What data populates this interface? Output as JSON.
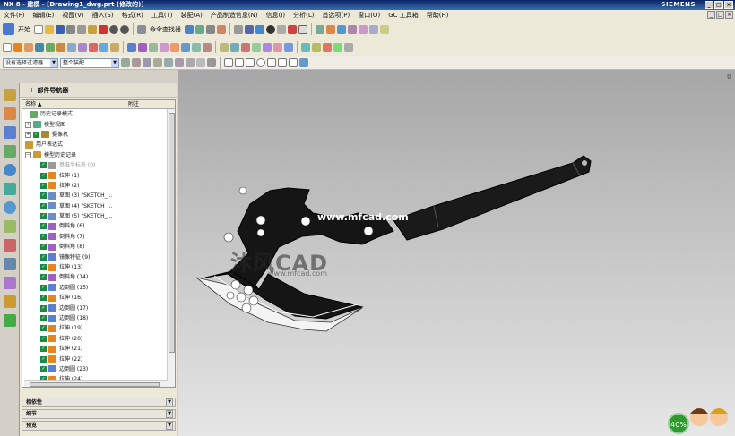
{
  "window": {
    "app_title": "NX 8 - 建模 - [Drawing1_dwg.prt (修改的)]",
    "brand": "SIEMENS"
  },
  "menu": [
    "文件(F)",
    "编辑(E)",
    "视图(V)",
    "插入(S)",
    "格式(R)",
    "工具(T)",
    "装配(A)",
    "产品制造信息(N)",
    "信息(I)",
    "分析(L)",
    "首选项(P)",
    "窗口(O)",
    "GC 工具箱",
    "帮助(H)"
  ],
  "toolbar": {
    "start_label": "开始",
    "cmd_finder": "命令查找器"
  },
  "selection": {
    "filter": "没有选择过滤器",
    "scope": "整个装配"
  },
  "nav": {
    "title": "部件导航器",
    "col_name": "名称",
    "col_note": "附注",
    "items": [
      {
        "label": "历史记录模式",
        "style": "root",
        "color": "#6a6"
      },
      {
        "label": "模型视图",
        "style": "exp",
        "color": "#5a8"
      },
      {
        "label": "摄像机",
        "style": "exp",
        "color": "#a83"
      },
      {
        "label": "用户表达式",
        "style": "plain",
        "color": "#c93"
      },
      {
        "label": "模型历史记录",
        "style": "open",
        "color": "#c93"
      },
      {
        "label": "基准坐标系 (0)",
        "style": "gray",
        "color": "#999"
      },
      {
        "label": "拉伸 (1)",
        "style": "feat",
        "color": "#e8841c"
      },
      {
        "label": "拉伸 (2)",
        "style": "feat",
        "color": "#e8841c"
      },
      {
        "label": "草图 (3) \"SKETCH_...",
        "style": "feat",
        "color": "#6a8cc8"
      },
      {
        "label": "草图 (4) \"SKETCH_...",
        "style": "feat",
        "color": "#6a8cc8"
      },
      {
        "label": "草图 (5) \"SKETCH_...",
        "style": "feat",
        "color": "#6a8cc8"
      },
      {
        "label": "倒斜角 (6)",
        "style": "feat",
        "color": "#a060c0"
      },
      {
        "label": "倒斜角 (7)",
        "style": "feat",
        "color": "#a060c0"
      },
      {
        "label": "倒斜角 (8)",
        "style": "feat",
        "color": "#a060c0"
      },
      {
        "label": "镜像特征 (9)",
        "style": "feat",
        "color": "#5a80d0"
      },
      {
        "label": "拉伸 (13)",
        "style": "feat",
        "color": "#e8841c"
      },
      {
        "label": "倒斜角 (14)",
        "style": "feat",
        "color": "#a060c0"
      },
      {
        "label": "边倒圆 (15)",
        "style": "feat",
        "color": "#5a80d0"
      },
      {
        "label": "拉伸 (16)",
        "style": "feat",
        "color": "#e8841c"
      },
      {
        "label": "边倒圆 (17)",
        "style": "feat",
        "color": "#5a80d0"
      },
      {
        "label": "边倒圆 (18)",
        "style": "feat",
        "color": "#5a80d0"
      },
      {
        "label": "拉伸 (19)",
        "style": "feat",
        "color": "#e8841c"
      },
      {
        "label": "拉伸 (20)",
        "style": "feat",
        "color": "#e8841c"
      },
      {
        "label": "拉伸 (21)",
        "style": "feat",
        "color": "#e8841c"
      },
      {
        "label": "拉伸 (22)",
        "style": "feat",
        "color": "#e8841c"
      },
      {
        "label": "边倒圆 (23)",
        "style": "feat",
        "color": "#5a80d0"
      },
      {
        "label": "拉伸 (24)",
        "style": "feat",
        "color": "#e8841c"
      }
    ],
    "panels": [
      "相依性",
      "细节",
      "预览"
    ]
  },
  "viewport": {
    "watermark_url": "www.mfcad.com",
    "logo_text": "沐风CAD",
    "logo_sub": "www.mfcad.com"
  },
  "status": {
    "zoom": "40%"
  }
}
